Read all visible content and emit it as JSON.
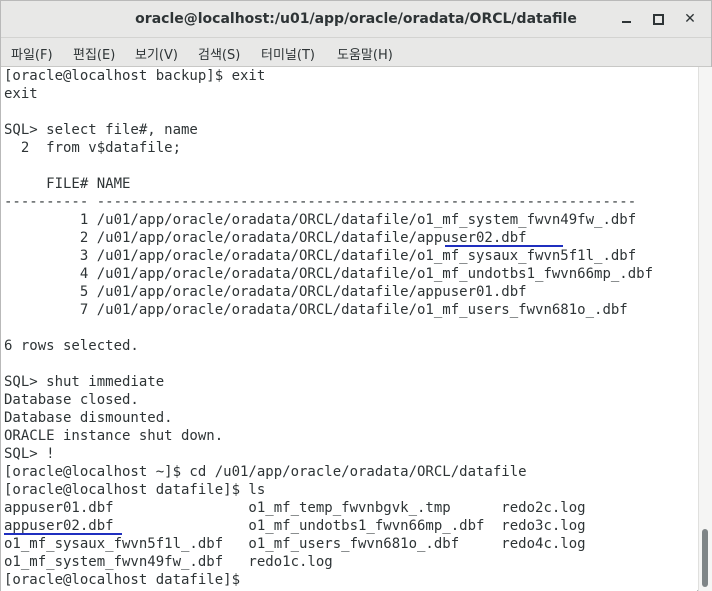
{
  "window": {
    "title": "oracle@localhost:/u01/app/oracle/oradata/ORCL/datafile",
    "minimize_icon": "minimize-icon",
    "maximize_icon": "maximize-icon",
    "close_icon": "close-icon",
    "close_glyph": "✕"
  },
  "menu": [
    {
      "label": "파일(F)"
    },
    {
      "label": "편집(E)"
    },
    {
      "label": "보기(V)"
    },
    {
      "label": "검색(S)"
    },
    {
      "label": "터미널(T)"
    },
    {
      "label": "도움말(H)"
    }
  ],
  "terminal": {
    "lines": [
      "[oracle@localhost backup]$ exit",
      "exit",
      "",
      "SQL> select file#, name",
      "  2  from v$datafile;",
      "",
      "     FILE# NAME",
      "---------- ----------------------------------------------------------------",
      "         1 /u01/app/oracle/oradata/ORCL/datafile/o1_mf_system_fwvn49fw_.dbf",
      "         2 /u01/app/oracle/oradata/ORCL/datafile/appuser02.dbf",
      "         3 /u01/app/oracle/oradata/ORCL/datafile/o1_mf_sysaux_fwvn5f1l_.dbf",
      "         4 /u01/app/oracle/oradata/ORCL/datafile/o1_mf_undotbs1_fwvn66mp_.dbf",
      "         5 /u01/app/oracle/oradata/ORCL/datafile/appuser01.dbf",
      "         7 /u01/app/oracle/oradata/ORCL/datafile/o1_mf_users_fwvn681o_.dbf",
      "",
      "6 rows selected.",
      "",
      "SQL> shut immediate",
      "Database closed.",
      "Database dismounted.",
      "ORACLE instance shut down.",
      "SQL> !",
      "[oracle@localhost ~]$ cd /u01/app/oracle/oradata/ORCL/datafile",
      "[oracle@localhost datafile]$ ls",
      "appuser01.dbf                o1_mf_temp_fwvnbgvk_.tmp      redo2c.log",
      "appuser02.dbf                o1_mf_undotbs1_fwvn66mp_.dbf  redo3c.log",
      "o1_mf_sysaux_fwvn5f1l_.dbf   o1_mf_users_fwvn681o_.dbf     redo4c.log",
      "o1_mf_system_fwvn49fw_.dbf   redo1c.log",
      "[oracle@localhost datafile]$ "
    ]
  },
  "colors": {
    "underline": "#1f2fbf",
    "text": "#2e3436"
  }
}
